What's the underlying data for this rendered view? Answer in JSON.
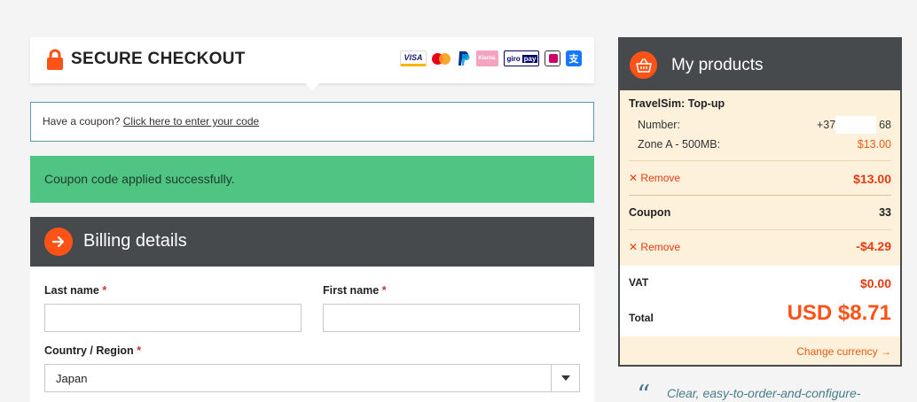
{
  "checkout": {
    "title": "SECURE CHECKOUT",
    "payment_icons": [
      "visa-icon",
      "mastercard-icon",
      "paypal-icon",
      "klarna-icon",
      "giropay-icon",
      "ideal-icon",
      "alipay-icon"
    ],
    "visa_label": "VISA",
    "klarna_label": "Klarna.",
    "giropay_label": "giro",
    "giropay_label2": "pay"
  },
  "coupon": {
    "prompt": "Have a coupon?",
    "link": "Click here to enter your code"
  },
  "notice": {
    "success": "Coupon code applied successfully."
  },
  "billing": {
    "title": "Billing details",
    "last_name_label": "Last name",
    "first_name_label": "First name",
    "country_label": "Country / Region",
    "required_mark": "*",
    "country_value": "Japan"
  },
  "products": {
    "title": "My products",
    "item_name": "TravelSim: Top-up",
    "number_label": "Number:",
    "number_value_prefix": "+372",
    "number_value_suffix": "68",
    "zone_label": "Zone A - 500MB:",
    "zone_price": "$13.00",
    "remove_label": "Remove",
    "item_total": "$13.00",
    "coupon_label": "Coupon",
    "coupon_code": "33",
    "coupon_discount": "-$4.29",
    "vat_label": "VAT",
    "vat_value": "$0.00",
    "total_label": "Total",
    "total_value": "USD $8.71",
    "change_currency": "Change currency"
  },
  "testimonial": {
    "quote_mark": "“",
    "text": "Clear, easy-to-order-and-configure-"
  },
  "colors": {
    "accent": "#fe5216",
    "dark_header": "#474a4c",
    "success_bg": "#4fc483",
    "summary_bg": "#fdf1dc"
  }
}
